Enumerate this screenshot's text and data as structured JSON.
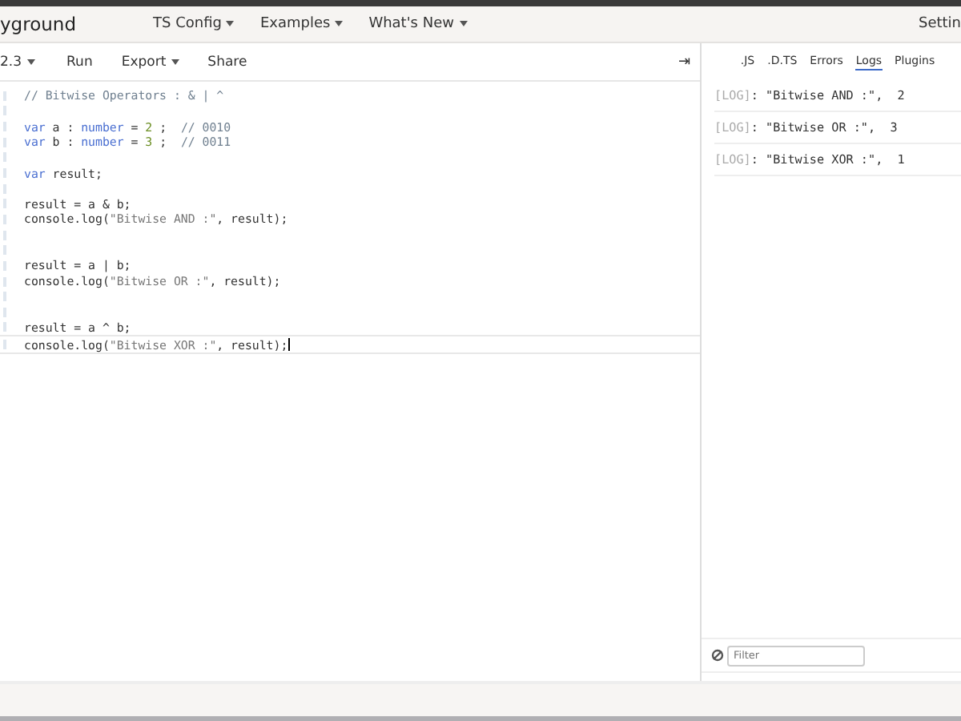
{
  "header": {
    "title": "yground",
    "menus": [
      {
        "label": "TS Config",
        "dropdown": true
      },
      {
        "label": "Examples",
        "dropdown": true
      },
      {
        "label": "What's New",
        "dropdown": true
      }
    ],
    "settings": "Settin"
  },
  "toolbar": {
    "items": [
      {
        "label": "2.3",
        "dropdown": true
      },
      {
        "label": "Run",
        "dropdown": false
      },
      {
        "label": "Export",
        "dropdown": true
      },
      {
        "label": "Share",
        "dropdown": false
      }
    ],
    "collapse": "⇥"
  },
  "editor": {
    "lines": [
      {
        "current": false,
        "tokens": [
          {
            "kind": "comment",
            "text": "// Bitwise Operators : & | ^"
          }
        ]
      },
      {
        "current": false
      },
      {
        "current": false,
        "tokens": [
          {
            "kind": "keyword",
            "text": "var"
          },
          {
            "kind": "plain",
            "text": " a : "
          },
          {
            "kind": "type",
            "text": "number"
          },
          {
            "kind": "plain",
            "text": " = "
          },
          {
            "kind": "number",
            "text": "2"
          },
          {
            "kind": "plain",
            "text": " ;  "
          },
          {
            "kind": "comment",
            "text": "// 0010"
          }
        ]
      },
      {
        "current": false,
        "tokens": [
          {
            "kind": "keyword",
            "text": "var"
          },
          {
            "kind": "plain",
            "text": " b : "
          },
          {
            "kind": "type",
            "text": "number"
          },
          {
            "kind": "plain",
            "text": " = "
          },
          {
            "kind": "number",
            "text": "3"
          },
          {
            "kind": "plain",
            "text": " ;  "
          },
          {
            "kind": "comment",
            "text": "// 0011"
          }
        ]
      },
      {
        "current": false
      },
      {
        "current": false,
        "tokens": [
          {
            "kind": "keyword",
            "text": "var"
          },
          {
            "kind": "plain",
            "text": " result;"
          }
        ]
      },
      {
        "current": false
      },
      {
        "current": false,
        "tokens": [
          {
            "kind": "plain",
            "text": "result = a & b;"
          }
        ]
      },
      {
        "current": false,
        "tokens": [
          {
            "kind": "plain",
            "text": "console.log("
          },
          {
            "kind": "string",
            "text": "\"Bitwise AND :\""
          },
          {
            "kind": "plain",
            "text": ", result);"
          }
        ]
      },
      {
        "current": false
      },
      {
        "current": false
      },
      {
        "current": false,
        "tokens": [
          {
            "kind": "plain",
            "text": "result = a | b;"
          }
        ]
      },
      {
        "current": false,
        "tokens": [
          {
            "kind": "plain",
            "text": "console.log("
          },
          {
            "kind": "string",
            "text": "\"Bitwise OR :\""
          },
          {
            "kind": "plain",
            "text": ", result);"
          }
        ]
      },
      {
        "current": false
      },
      {
        "current": false
      },
      {
        "current": false,
        "tokens": [
          {
            "kind": "plain",
            "text": "result = a ^ b;"
          }
        ]
      },
      {
        "current": true,
        "tokens": [
          {
            "kind": "plain",
            "text": "console.log("
          },
          {
            "kind": "string",
            "text": "\"Bitwise XOR :\""
          },
          {
            "kind": "plain",
            "text": ", result);"
          }
        ]
      }
    ]
  },
  "side_panel": {
    "tabs": [
      {
        "label": ".JS",
        "selected": false
      },
      {
        "label": ".D.TS",
        "selected": false
      },
      {
        "label": "Errors",
        "selected": false
      },
      {
        "label": "Logs",
        "selected": true
      },
      {
        "label": "Plugins",
        "selected": false
      }
    ],
    "logs": [
      {
        "tag": "[LOG]",
        "text": ": \"Bitwise AND :\",  2"
      },
      {
        "tag": "[LOG]",
        "text": ": \"Bitwise OR :\",  3"
      },
      {
        "tag": "[LOG]",
        "text": ": \"Bitwise XOR :\",  1"
      }
    ],
    "filter": {
      "placeholder": "Filter"
    }
  }
}
